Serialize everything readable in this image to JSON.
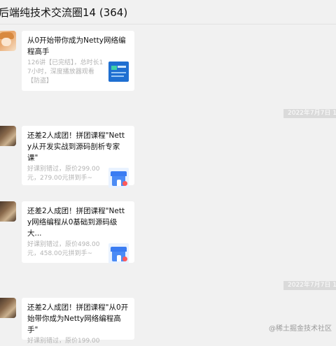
{
  "header": {
    "title": "后端纯技术交流圈14 (364)"
  },
  "timestamps": [
    "2022年7月7日 14",
    "2022年7月7日 14"
  ],
  "messages": [
    {
      "avatar": "anime-girl-avatar",
      "title": "从0开始带你成为Netty网络编程高手",
      "desc": "126讲【已完结】，总时长17小时，深度播放器观看【防盗】",
      "thumb": "course-cover-icon"
    },
    {
      "avatar": "photo-avatar",
      "title": "还差2人成团！拼团课程\"Netty从开发实战到源码剖析专家课\"",
      "desc": "好课别错过，原价299.00元，279.00元拼到手~",
      "thumb": "shop-icon"
    },
    {
      "avatar": "photo-avatar",
      "title": "还差2人成团！拼团课程\"Netty网络编程从0基础到源码级大...",
      "desc": "好课别错过，原价498.00元，458.00元拼到手~",
      "thumb": "shop-icon"
    },
    {
      "avatar": "photo-avatar",
      "title": "还差2人成团！拼团课程\"从0开始带你成为Netty网络编程高手\"",
      "desc": "好课别错过，原价199.00",
      "thumb": "shop-icon"
    }
  ],
  "watermark": "@稀土掘金技术社区"
}
